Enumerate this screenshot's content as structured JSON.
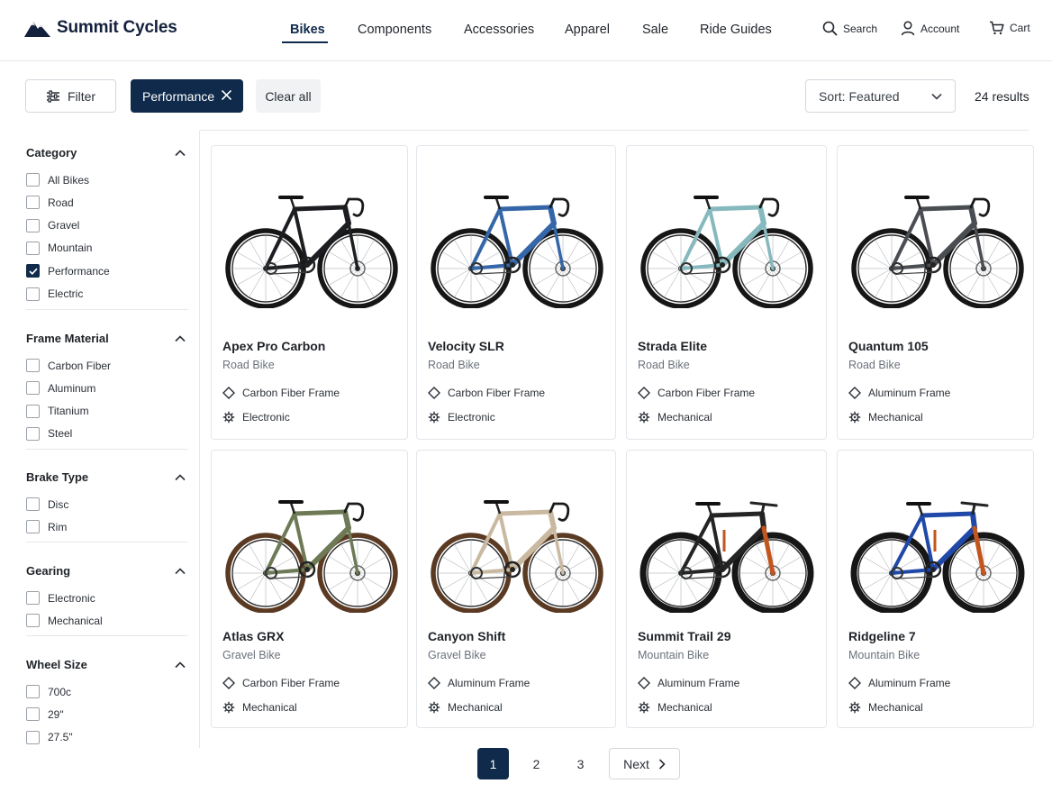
{
  "brand": {
    "name": "Summit Cycles",
    "accent": "#0f2a4a"
  },
  "nav": {
    "items": [
      {
        "label": "Bikes",
        "active": true
      },
      {
        "label": "Components"
      },
      {
        "label": "Accessories"
      },
      {
        "label": "Apparel"
      },
      {
        "label": "Sale"
      },
      {
        "label": "Ride Guides"
      }
    ],
    "utilities": [
      {
        "label": "Search",
        "icon": "search-icon"
      },
      {
        "label": "Account",
        "icon": "user-icon"
      },
      {
        "label": "Cart",
        "icon": "cart-icon"
      }
    ]
  },
  "toolbar": {
    "filter_label": "Filter",
    "active_chip": "Performance",
    "clear_label": "Clear all",
    "sort_label": "Sort: Featured",
    "results": "24 results"
  },
  "facets": [
    {
      "title": "Category",
      "options": [
        {
          "label": "All Bikes",
          "checked": false
        },
        {
          "label": "Road",
          "checked": false
        },
        {
          "label": "Gravel",
          "checked": false
        },
        {
          "label": "Mountain",
          "checked": false
        },
        {
          "label": "Performance",
          "checked": true
        },
        {
          "label": "Electric",
          "checked": false
        }
      ]
    },
    {
      "title": "Frame Material",
      "options": [
        {
          "label": "Carbon Fiber",
          "checked": false
        },
        {
          "label": "Aluminum",
          "checked": false
        },
        {
          "label": "Titanium",
          "checked": false
        },
        {
          "label": "Steel",
          "checked": false
        }
      ]
    },
    {
      "title": "Brake Type",
      "options": [
        {
          "label": "Disc",
          "checked": false
        },
        {
          "label": "Rim",
          "checked": false
        }
      ]
    },
    {
      "title": "Gearing",
      "options": [
        {
          "label": "Electronic",
          "checked": false
        },
        {
          "label": "Mechanical",
          "checked": false
        }
      ]
    },
    {
      "title": "Wheel Size",
      "options": [
        {
          "label": "700c",
          "checked": false
        },
        {
          "label": "29\"",
          "checked": false
        },
        {
          "label": "27.5\"",
          "checked": false
        }
      ]
    }
  ],
  "products": [
    {
      "name": "Apex Pro Carbon",
      "type": "Road Bike",
      "frame": "Carbon Fiber Frame",
      "gearing": "Electronic",
      "color": "#1c1e21",
      "bike_style": "road"
    },
    {
      "name": "Velocity SLR",
      "type": "Road Bike",
      "frame": "Carbon Fiber Frame",
      "gearing": "Electronic",
      "color": "#3566a8",
      "bike_style": "road"
    },
    {
      "name": "Strada Elite",
      "type": "Road Bike",
      "frame": "Carbon Fiber Frame",
      "gearing": "Mechanical",
      "color": "#86b9bd",
      "bike_style": "road"
    },
    {
      "name": "Quantum 105",
      "type": "Road Bike",
      "frame": "Aluminum Frame",
      "gearing": "Mechanical",
      "color": "#4a4d52",
      "bike_style": "road"
    },
    {
      "name": "Atlas GRX",
      "type": "Gravel Bike",
      "frame": "Carbon Fiber Frame",
      "gearing": "Mechanical",
      "color": "#6d7a55",
      "bike_style": "gravel"
    },
    {
      "name": "Canyon Shift",
      "type": "Gravel Bike",
      "frame": "Aluminum Frame",
      "gearing": "Mechanical",
      "color": "#c9b9a0",
      "bike_style": "gravel"
    },
    {
      "name": "Summit Trail 29",
      "type": "Mountain Bike",
      "frame": "Aluminum Frame",
      "gearing": "Mechanical",
      "color": "#242424",
      "accent": "#c2561e",
      "bike_style": "mtb"
    },
    {
      "name": "Ridgeline 7",
      "type": "Mountain Bike",
      "frame": "Aluminum Frame",
      "gearing": "Mechanical",
      "color": "#1f48a8",
      "accent": "#c2561e",
      "bike_style": "mtb"
    }
  ],
  "pagination": {
    "pages": [
      "1",
      "2",
      "3"
    ],
    "current": "1",
    "next_label": "Next"
  }
}
